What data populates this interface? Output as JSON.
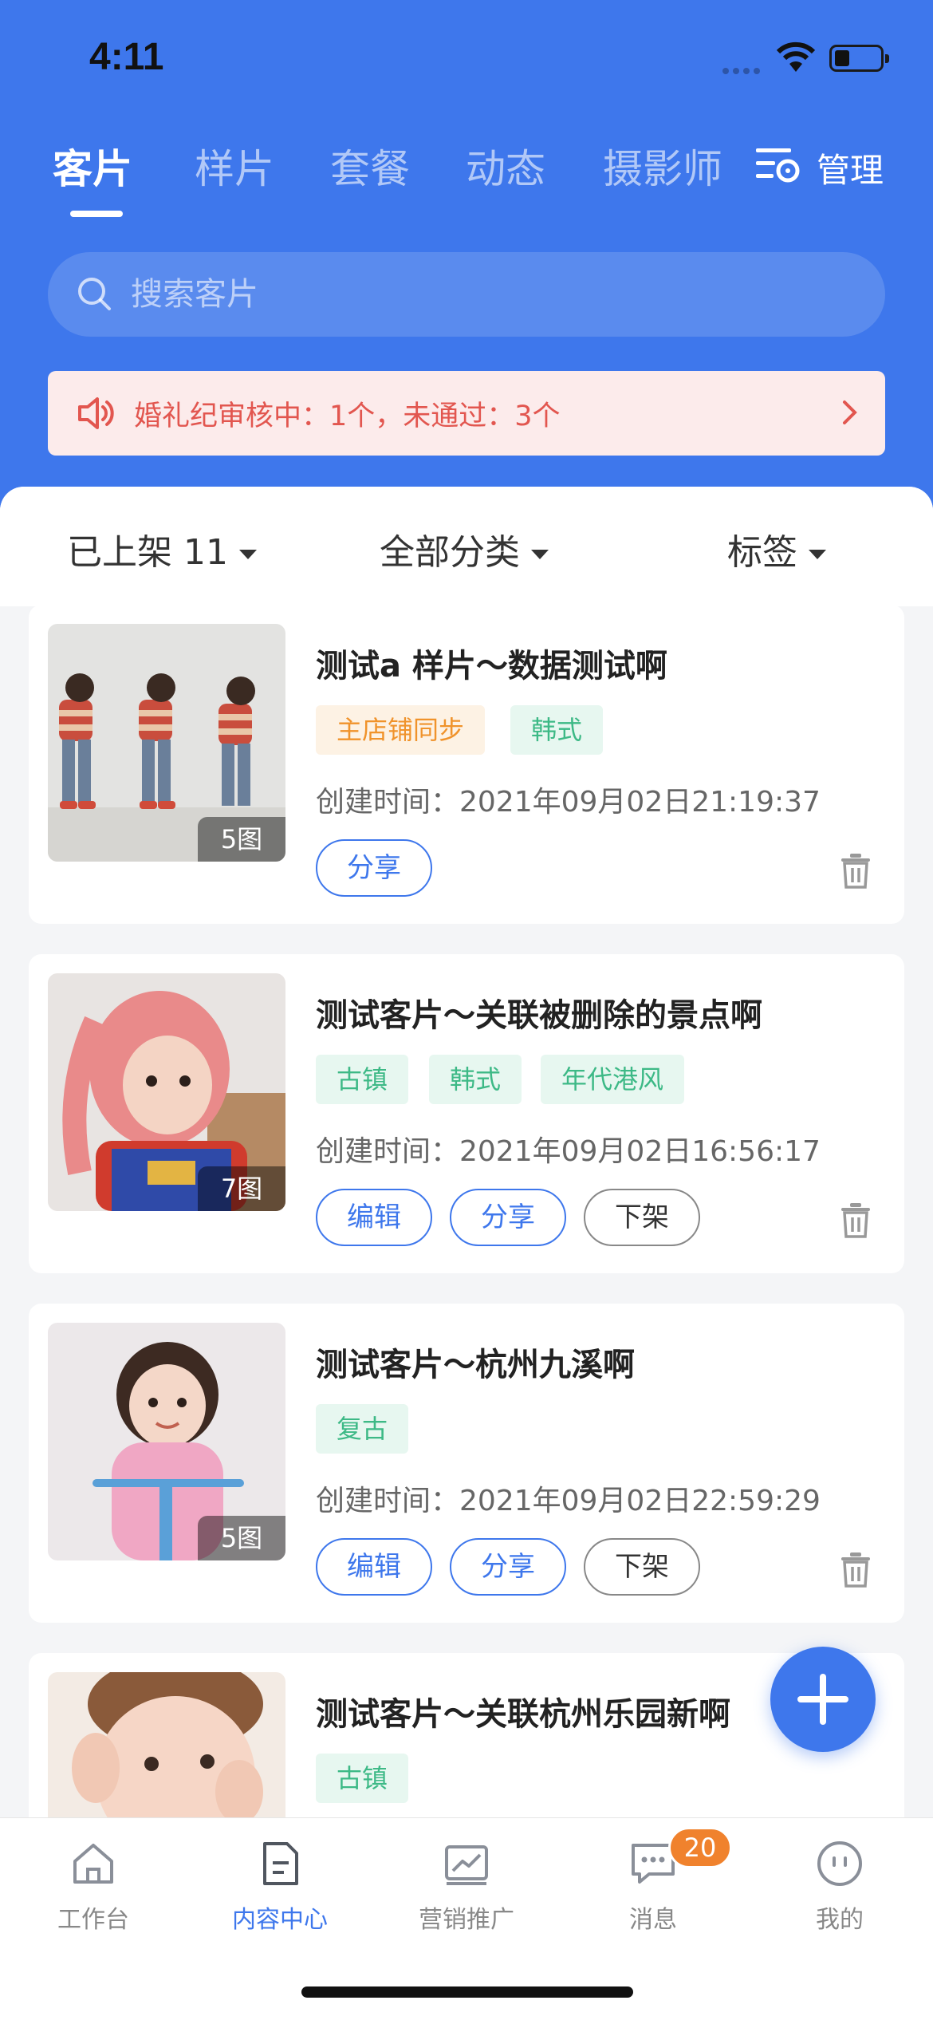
{
  "status_bar": {
    "time": "4:11"
  },
  "tabs": [
    {
      "label": "客片",
      "active": true
    },
    {
      "label": "样片",
      "active": false
    },
    {
      "label": "套餐",
      "active": false
    },
    {
      "label": "动态",
      "active": false
    },
    {
      "label": "摄影师",
      "active": false
    }
  ],
  "manage": {
    "label": "管理",
    "icon": "manage-filter-icon"
  },
  "search": {
    "placeholder": "搜索客片",
    "value": ""
  },
  "notice": {
    "text": "婚礼纪审核中：1个，未通过：3个",
    "icon": "speaker-icon"
  },
  "filters": {
    "status": "已上架 11",
    "category": "全部分类",
    "tag": "标签"
  },
  "cards": [
    {
      "title": "测试a 样片～数据测试啊",
      "tags": [
        {
          "label": "主店铺同步",
          "style": "orange"
        },
        {
          "label": "韩式",
          "style": "green"
        }
      ],
      "created": "创建时间：2021年09月02日21:19:37",
      "pics": "5图",
      "actions": [
        "分享"
      ]
    },
    {
      "title": "测试客片～关联被删除的景点啊",
      "tags": [
        {
          "label": "古镇",
          "style": "green"
        },
        {
          "label": "韩式",
          "style": "green"
        },
        {
          "label": "年代港风",
          "style": "green"
        }
      ],
      "created": "创建时间：2021年09月02日16:56:17",
      "pics": "7图",
      "actions": [
        "编辑",
        "分享",
        "下架"
      ]
    },
    {
      "title": "测试客片～杭州九溪啊",
      "tags": [
        {
          "label": "复古",
          "style": "green"
        }
      ],
      "created": "创建时间：2021年09月02日22:59:29",
      "pics": "5图",
      "actions": [
        "编辑",
        "分享",
        "下架"
      ]
    },
    {
      "title": "测试客片～关联杭州乐园新啊",
      "tags": [
        {
          "label": "古镇",
          "style": "green"
        }
      ],
      "created": "",
      "pics": "",
      "actions": []
    }
  ],
  "bottom_nav": [
    {
      "label": "工作台",
      "icon": "home-icon",
      "active": false
    },
    {
      "label": "内容中心",
      "icon": "document-icon",
      "active": true
    },
    {
      "label": "营销推广",
      "icon": "chart-icon",
      "active": false
    },
    {
      "label": "消息",
      "icon": "message-icon",
      "active": false
    },
    {
      "label": "我的",
      "icon": "profile-icon",
      "active": false
    }
  ],
  "message_badge": "20",
  "colors": {
    "primary": "#3e77ec",
    "notice_bg": "#fcebeb",
    "notice_text": "#e2564f",
    "tag_green": "#3db986",
    "tag_orange": "#f0932b",
    "badge": "#f0822d"
  }
}
